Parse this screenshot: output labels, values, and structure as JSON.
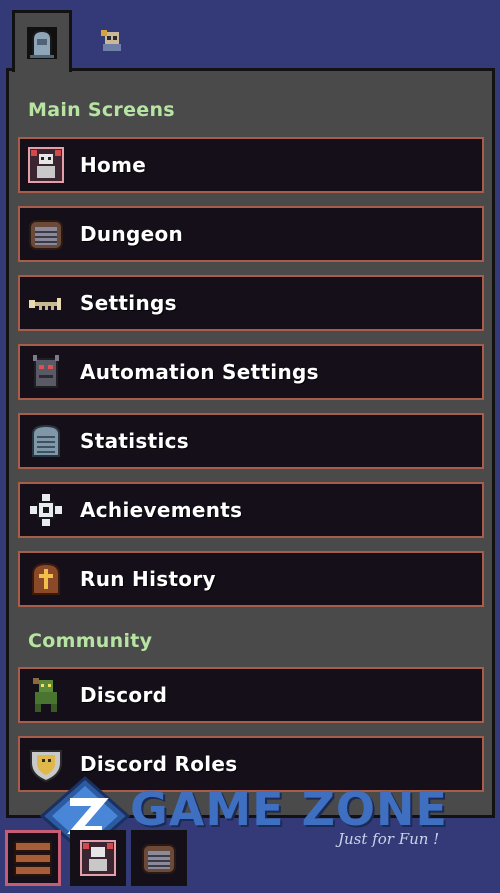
{
  "tabs": [
    {
      "name": "tab-menu",
      "icon": "gravestone-icon",
      "active": true
    },
    {
      "name": "tab-character",
      "icon": "character-icon",
      "active": false
    }
  ],
  "sections": [
    {
      "title": "Main Screens",
      "items": [
        {
          "label": "Home",
          "icon": "home-icon"
        },
        {
          "label": "Dungeon",
          "icon": "dungeon-gate-icon"
        },
        {
          "label": "Settings",
          "icon": "key-icon"
        },
        {
          "label": "Automation Settings",
          "icon": "robot-icon"
        },
        {
          "label": "Statistics",
          "icon": "tablet-icon"
        },
        {
          "label": "Achievements",
          "icon": "cross-emblem-icon"
        },
        {
          "label": "Run History",
          "icon": "tombstone-cross-icon"
        }
      ]
    },
    {
      "title": "Community",
      "items": [
        {
          "label": "Discord",
          "icon": "goblin-icon"
        },
        {
          "label": "Discord Roles",
          "icon": "shield-crest-icon"
        }
      ]
    }
  ],
  "watermark": {
    "text": "GAME ZONE",
    "tagline": "Just for Fun !"
  },
  "bottom_bar": [
    {
      "name": "menu-toggle-button",
      "icon": "hamburger-icon",
      "active": true
    },
    {
      "name": "home-shortcut-button",
      "icon": "home-icon",
      "active": false
    },
    {
      "name": "dungeon-shortcut-button",
      "icon": "dungeon-gate-icon",
      "active": false
    }
  ],
  "colors": {
    "background": "#343a78",
    "panel": "#4a4a4a",
    "button_bg": "#150f1a",
    "button_border": "#a85d4b",
    "section_title": "#b7e4a2"
  }
}
